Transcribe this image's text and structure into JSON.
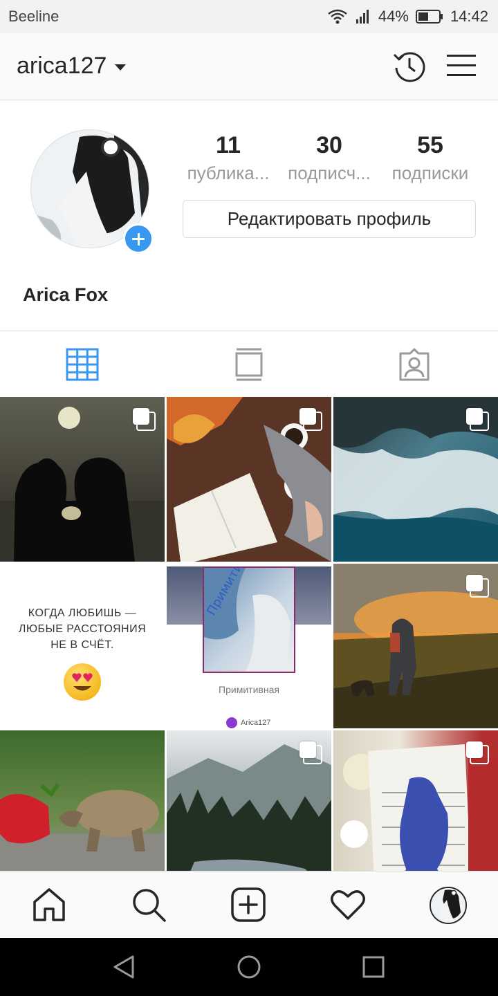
{
  "status_bar": {
    "carrier": "Beeline",
    "battery_percent": "44%",
    "time": "14:42",
    "icons": [
      "wifi-icon",
      "signal-icon",
      "battery-icon"
    ]
  },
  "header": {
    "username": "arica127",
    "icons": [
      "chevron-down-icon",
      "history-icon",
      "menu-icon"
    ]
  },
  "profile": {
    "stats": [
      {
        "value": "11",
        "label": "публика..."
      },
      {
        "value": "30",
        "label": "подписч..."
      },
      {
        "value": "55",
        "label": "подписки"
      }
    ],
    "edit_button": "Редактировать профиль",
    "full_name": "Arica Fox"
  },
  "tabs": [
    {
      "icon": "grid-icon",
      "active": true
    },
    {
      "icon": "feed-icon",
      "active": false
    },
    {
      "icon": "tagged-icon",
      "active": false
    }
  ],
  "posts": {
    "quote_text": "КОГДА ЛЮБИШЬ —\nЛЮБЫЕ РАССТОЯНИЯ\nНЕ В СЧЁТ.",
    "poster_title": "Примитивная",
    "poster_author": "Arica127"
  },
  "bottom_nav": [
    "home-icon",
    "search-icon",
    "add-icon",
    "heart-icon",
    "profile-avatar"
  ],
  "system_nav": [
    "back-icon",
    "home-circle-icon",
    "recents-icon"
  ],
  "colors": {
    "accent": "#3897f0",
    "text": "#262626",
    "secondary_text": "#999999",
    "border": "#dbdbdb"
  }
}
